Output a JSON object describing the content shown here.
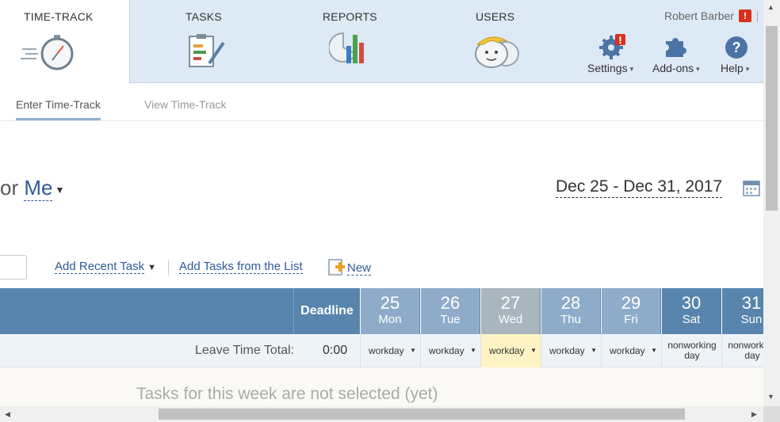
{
  "nav": {
    "tabs": [
      {
        "label": "TIME-TRACK",
        "icon": "stopwatch-icon"
      },
      {
        "label": "TASKS",
        "icon": "clipboard-icon"
      },
      {
        "label": "REPORTS",
        "icon": "bar-chart-icon"
      },
      {
        "label": "USERS",
        "icon": "users-icon"
      }
    ],
    "user_name": "Robert Barber",
    "alert_badge": "!",
    "tools": {
      "settings": "Settings",
      "addons": "Add-ons",
      "help": "Help"
    }
  },
  "subtabs": {
    "enter": "Enter Time-Track",
    "view": "View Time-Track"
  },
  "main": {
    "for_prefix": "or",
    "user": "Me",
    "date_range": "Dec 25 - Dec 31, 2017"
  },
  "actions": {
    "add_recent": "Add Recent Task",
    "add_from_list": "Add Tasks from the List",
    "new_label": "New"
  },
  "grid": {
    "deadline_header": "Deadline",
    "days": [
      {
        "num": "25",
        "dow": "Mon",
        "status": "workday"
      },
      {
        "num": "26",
        "dow": "Tue",
        "status": "workday"
      },
      {
        "num": "27",
        "dow": "Wed",
        "status": "workday"
      },
      {
        "num": "28",
        "dow": "Thu",
        "status": "workday"
      },
      {
        "num": "29",
        "dow": "Fri",
        "status": "workday"
      },
      {
        "num": "30",
        "dow": "Sat",
        "status": "nonworking day"
      },
      {
        "num": "31",
        "dow": "Sun",
        "status": "nonworking day"
      }
    ],
    "leave_label": "Leave Time Total:",
    "leave_value": "0:00",
    "empty_message": "Tasks for this week are not selected (yet)"
  },
  "colors": {
    "header_blue": "#5785ad",
    "weekday_blue": "#8eacc9",
    "today_gray": "#a9b6bd",
    "today_highlight": "#fdf3c4",
    "link_blue": "#2f5a99",
    "alert_red": "#d9301c"
  }
}
